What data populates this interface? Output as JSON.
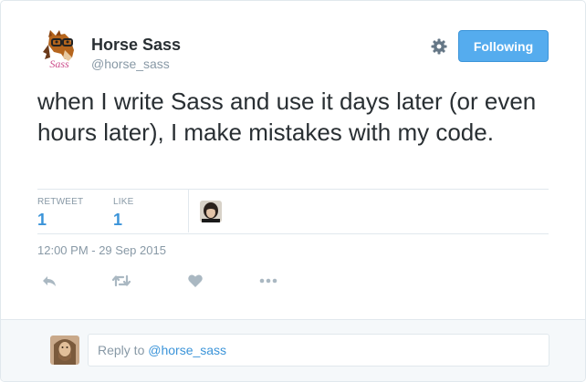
{
  "author": {
    "display_name": "Horse Sass",
    "handle": "@horse_sass",
    "logo_text": "Sass"
  },
  "follow_button_label": "Following",
  "tweet": {
    "text": "when I write Sass and use it days later (or even hours later), I make mistakes with my code.",
    "timestamp": "12:00 PM - 29 Sep 2015"
  },
  "stats": {
    "retweet_label": "RETWEET",
    "retweet_count": "1",
    "like_label": "LIKE",
    "like_count": "1"
  },
  "actions": [
    "reply-icon",
    "retweet-icon",
    "heart-icon",
    "more-icon"
  ],
  "reply": {
    "prefix": "Reply to ",
    "mention": "@horse_sass"
  },
  "colors": {
    "accent": "#55acee",
    "link": "#3b94d9",
    "muted": "#8899a6",
    "border": "#e1e8ed",
    "reply_bg": "#f5f8fa"
  }
}
